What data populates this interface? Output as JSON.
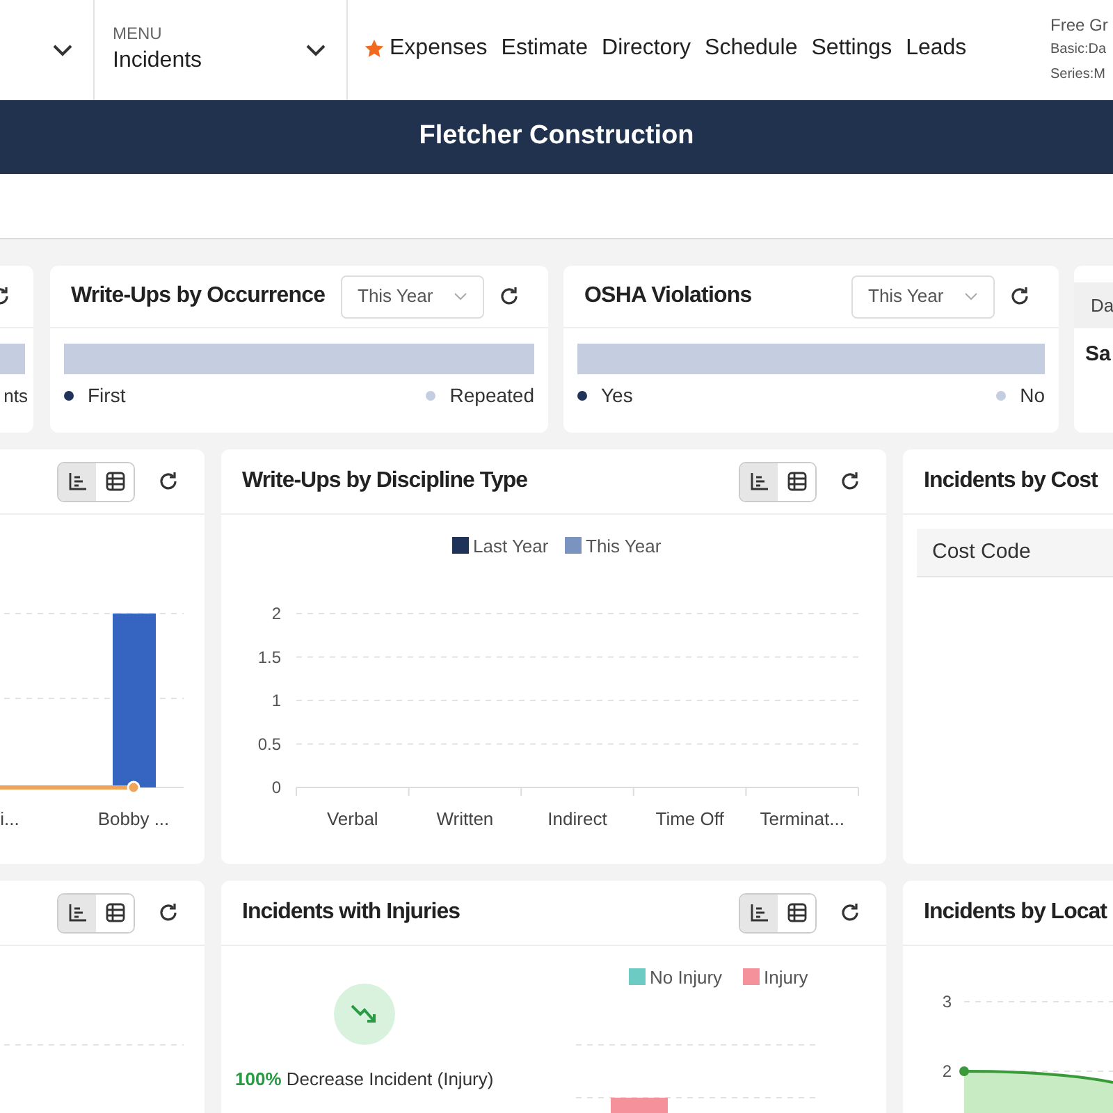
{
  "menu": {
    "label": "MENU",
    "value": "Incidents"
  },
  "nav_links": [
    {
      "label": "Expenses",
      "starred": true
    },
    {
      "label": "Estimate",
      "starred": false
    },
    {
      "label": "Directory",
      "starred": false
    },
    {
      "label": "Schedule",
      "starred": false
    },
    {
      "label": "Settings",
      "starred": false
    },
    {
      "label": "Leads",
      "starred": false
    }
  ],
  "account_lines": [
    "Free Gr",
    "Basic:Da",
    "Series:M"
  ],
  "banner": {
    "title": "Fletcher Construction"
  },
  "summary_cards": [
    {
      "kind": "partial",
      "legend": [
        {
          "label": "nts"
        }
      ]
    },
    {
      "kind": "distribution",
      "title": "Write-Ups by Occurrence",
      "period": "This Year",
      "legend": [
        {
          "label": "First",
          "color": "#1f3358"
        },
        {
          "label": "Repeated",
          "color": "#c5cde0"
        }
      ]
    },
    {
      "kind": "distribution",
      "title": "OSHA Violations",
      "period": "This Year",
      "legend": [
        {
          "label": "Yes",
          "color": "#1f3358"
        },
        {
          "label": "No",
          "color": "#c5cde0"
        }
      ]
    },
    {
      "kind": "stat",
      "header": "Da",
      "value": "Sa"
    }
  ],
  "chart_cards": [
    {
      "kind": "bars_partial",
      "views": [
        {
          "kind": "chart",
          "selected": true
        },
        {
          "kind": "table",
          "selected": false
        }
      ],
      "labels": [
        "i...",
        "Bobby ..."
      ]
    },
    {
      "kind": "bar_chart",
      "title": "Write-Ups by Discipline Type",
      "views": [
        {
          "kind": "chart",
          "selected": true
        },
        {
          "kind": "table",
          "selected": false
        }
      ],
      "chart_data": {
        "type": "bar",
        "grid": true,
        "categories": [
          "Verbal",
          "Written",
          "Indirect",
          "Time Off",
          "Terminat..."
        ],
        "yticks": [
          0,
          0.5,
          1,
          1.5,
          2
        ],
        "ylim": [
          0,
          2
        ],
        "series": [
          {
            "name": "Last Year",
            "color": "#1f3358",
            "values": [
              0,
              0,
              0,
              0,
              0
            ]
          },
          {
            "name": "This Year",
            "color": "#7b93bf",
            "values": [
              0,
              0,
              0,
              0,
              0
            ]
          }
        ]
      }
    },
    {
      "kind": "table",
      "title": "Incidents by Cost",
      "columns": [
        "Cost Code"
      ]
    },
    {
      "kind": "blank_partial",
      "views": [
        {
          "kind": "chart",
          "selected": true
        },
        {
          "kind": "table",
          "selected": false
        }
      ]
    },
    {
      "kind": "injuries",
      "title": "Incidents with Injuries",
      "views": [
        {
          "kind": "chart",
          "selected": true
        },
        {
          "kind": "table",
          "selected": false
        }
      ],
      "change": "100%",
      "change_text": "Decrease Incident (Injury)",
      "legend": [
        {
          "label": "No Injury",
          "color": "#6cccc4"
        },
        {
          "label": "Injury",
          "color": "#f4919a"
        }
      ]
    },
    {
      "kind": "area_partial",
      "title": "Incidents by Locat",
      "y_tick_labels": [
        "3",
        "2"
      ]
    }
  ]
}
